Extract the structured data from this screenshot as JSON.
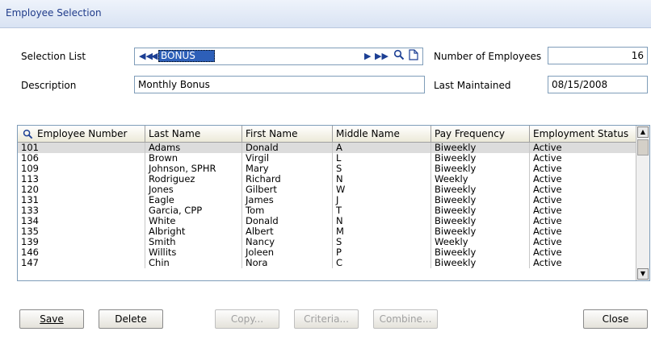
{
  "window": {
    "title": "Employee Selection"
  },
  "form": {
    "selection_list_label": "Selection List",
    "selection_list_value": "BONUS",
    "number_of_employees_label": "Number of Employees",
    "number_of_employees_value": "16",
    "description_label": "Description",
    "description_value": "Monthly Bonus",
    "last_maintained_label": "Last Maintained",
    "last_maintained_value": "08/15/2008"
  },
  "grid": {
    "columns": [
      "Employee Number",
      "Last Name",
      "First Name",
      "Middle Name",
      "Pay Frequency",
      "Employment Status"
    ],
    "rows": [
      [
        "101",
        "Adams",
        "Donald",
        "A",
        "Biweekly",
        "Active"
      ],
      [
        "106",
        "Brown",
        "Virgil",
        "L",
        "Biweekly",
        "Active"
      ],
      [
        "109",
        "Johnson, SPHR",
        "Mary",
        "S",
        "Biweekly",
        "Active"
      ],
      [
        "113",
        "Rodriguez",
        "Richard",
        "N",
        "Weekly",
        "Active"
      ],
      [
        "120",
        "Jones",
        "Gilbert",
        "W",
        "Biweekly",
        "Active"
      ],
      [
        "131",
        "Eagle",
        "James",
        "J",
        "Biweekly",
        "Active"
      ],
      [
        "133",
        "Garcia, CPP",
        "Tom",
        "T",
        "Biweekly",
        "Active"
      ],
      [
        "134",
        "White",
        "Donald",
        "N",
        "Biweekly",
        "Active"
      ],
      [
        "135",
        "Albright",
        "Albert",
        "M",
        "Biweekly",
        "Active"
      ],
      [
        "139",
        "Smith",
        "Nancy",
        "S",
        "Weekly",
        "Active"
      ],
      [
        "146",
        "Willits",
        "Joleen",
        "P",
        "Biweekly",
        "Active"
      ],
      [
        "147",
        "Chin",
        "Nora",
        "C",
        "Biweekly",
        "Active"
      ]
    ]
  },
  "buttons": {
    "save": "Save",
    "delete": "Delete",
    "copy": "Copy...",
    "criteria": "Criteria...",
    "combine": "Combine...",
    "close": "Close"
  },
  "icons": {
    "first": "first-record-icon",
    "prev": "previous-record-icon",
    "next": "next-record-icon",
    "last": "last-record-icon",
    "lookup": "search-icon",
    "new": "new-document-icon",
    "column_search": "search-icon"
  },
  "colors": {
    "title_text": "#1f3b8a",
    "selection_highlight": "#2d5fb8",
    "selected_row": "#dcdcdc"
  }
}
